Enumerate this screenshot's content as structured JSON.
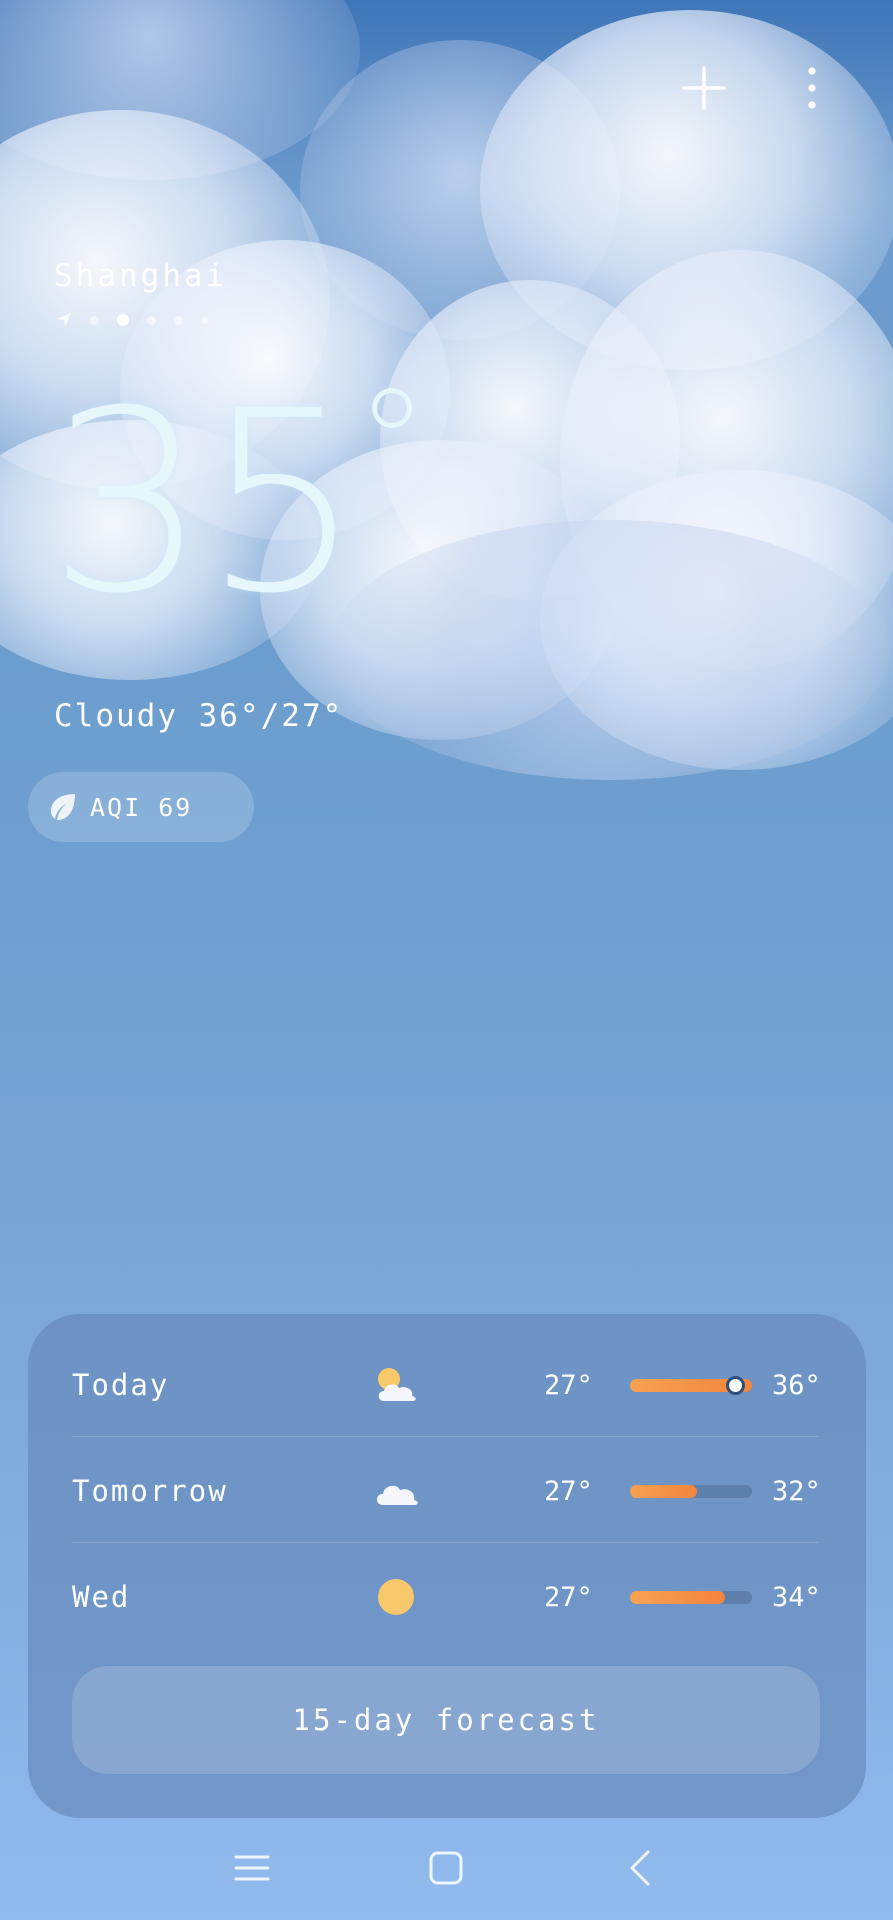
{
  "header": {
    "add_icon": "plus-icon",
    "menu_icon": "more-vertical-icon"
  },
  "location": {
    "city": "Shanghai",
    "page_count": 6,
    "active_page": 2,
    "location_icon": "navigation-arrow-icon"
  },
  "current": {
    "temperature": "35",
    "condition_line": "Cloudy  36°/27°"
  },
  "aqi": {
    "icon": "leaf-icon",
    "label": "AQI 69"
  },
  "forecast": {
    "days": [
      {
        "name": "Today",
        "icon": "partly-cloudy-icon",
        "low": "27°",
        "high": "36°",
        "range_fraction": 1.0,
        "current_fraction": 0.85
      },
      {
        "name": "Tomorrow",
        "icon": "cloud-icon",
        "low": "27°",
        "high": "32°",
        "range_fraction": 0.55
      },
      {
        "name": "Wed",
        "icon": "sun-icon",
        "low": "27°",
        "high": "34°",
        "range_fraction": 0.78
      }
    ],
    "button_label": "15-day forecast"
  },
  "colors": {
    "bar_fill_start": "#f6a251",
    "bar_fill_end": "#f3843f",
    "sun": "#f9c86a",
    "temp_text": "#e6f7fb"
  },
  "nav": {
    "menu_icon": "menu-lines-icon",
    "home_icon": "square-home-icon",
    "back_icon": "chevron-left-icon"
  }
}
